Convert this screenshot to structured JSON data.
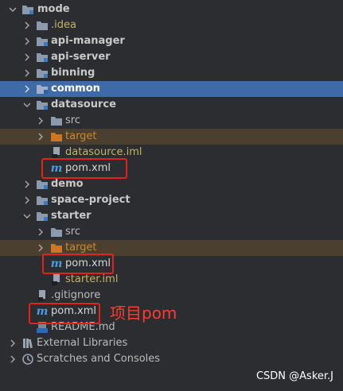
{
  "tree": {
    "root": "mode",
    "idea": ".idea",
    "api_manager": "api-manager",
    "api_server": "api-server",
    "binning": "binning",
    "common": "common",
    "datasource": "datasource",
    "datasource_src": "src",
    "datasource_target": "target",
    "datasource_iml": "datasource.iml",
    "datasource_pom": "pom.xml",
    "demo": "demo",
    "space_project": "space-project",
    "starter": "starter",
    "starter_src": "src",
    "starter_target": "target",
    "starter_pom": "pom.xml",
    "starter_iml": "starter.iml",
    "gitignore": ".gitignore",
    "root_pom": "pom.xml",
    "readme": "README.md",
    "external_libraries": "External Libraries",
    "scratches": "Scratches and Consoles"
  },
  "annotation": "项目pom",
  "watermark": "CSDN @Asker.J",
  "colors": {
    "background": "#2b2d30",
    "selection": "#3f6aa8",
    "excluded_row": "#4b3f2f",
    "highlight_box": "#e2231a",
    "annotation_text": "#ff3b30",
    "maven_icon": "#4d9be6"
  },
  "icons": {
    "expanded": "chevron-down-icon",
    "collapsed": "chevron-right-icon",
    "folder": "folder-icon",
    "module": "module-folder-icon",
    "excluded_folder": "excluded-folder-icon",
    "maven": "maven-icon",
    "iml": "iml-file-icon",
    "text_file": "text-file-icon",
    "markdown": "markdown-file-icon",
    "libraries": "libraries-icon",
    "scratches": "scratches-icon"
  }
}
